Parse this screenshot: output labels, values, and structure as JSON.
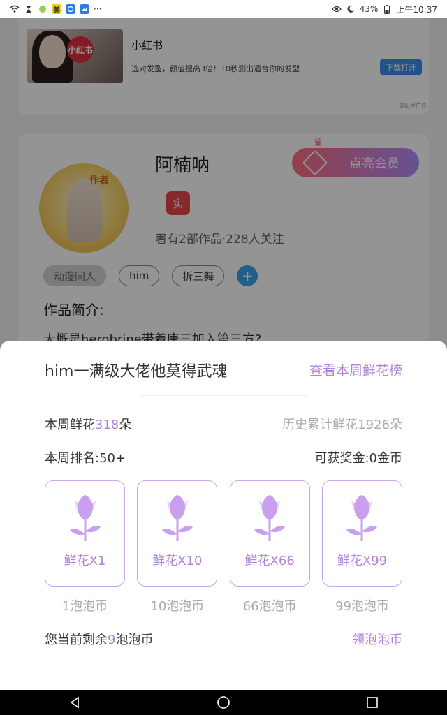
{
  "status_bar": {
    "battery": "43%",
    "time": "上午10:37",
    "ellipsis": "···",
    "app_badge": "美"
  },
  "ad": {
    "logo_text": "小红书",
    "title": "小红书",
    "description": "选对发型，颜值提高3倍！10秒测出适合你的发型",
    "button": "下载打开",
    "source": "穿山甲广告"
  },
  "author": {
    "avatar_tag": "作者",
    "name": "阿楠呐",
    "verified_badge": "实",
    "stats": "著有2部作品·228人关注",
    "vip_button": "点亮会员",
    "tags": [
      "动漫同人",
      "him",
      "拆三舞"
    ],
    "add_tag": "+",
    "intro_label": "作品简介:",
    "intro_text": "大概是herobrine带着唐三加入第三方?"
  },
  "sheet": {
    "title": "him一满级大佬他莫得武魂",
    "rank_link": "查看本周鲜花榜",
    "weekly_prefix": "本周鲜花",
    "weekly_count": "318",
    "weekly_suffix": "朵",
    "history": "历史累计鲜花1926朵",
    "weekly_rank": "本周排名:50+",
    "reward": "可获奖金:0金币",
    "gifts": [
      {
        "label": "鲜花X1",
        "price": "1泡泡币"
      },
      {
        "label": "鲜花X10",
        "price": "10泡泡币"
      },
      {
        "label": "鲜花X66",
        "price": "66泡泡币"
      },
      {
        "label": "鲜花X99",
        "price": "99泡泡币"
      }
    ],
    "balance_prefix": "您当前剩余",
    "balance_count": "9",
    "balance_suffix": "泡泡币",
    "get_coins": "领泡泡币"
  },
  "colors": {
    "accent": "#b084d8",
    "muted": "#aaaaaa",
    "vip_gradient_start": "#ff6e7e",
    "vip_gradient_end": "#b48cff"
  }
}
